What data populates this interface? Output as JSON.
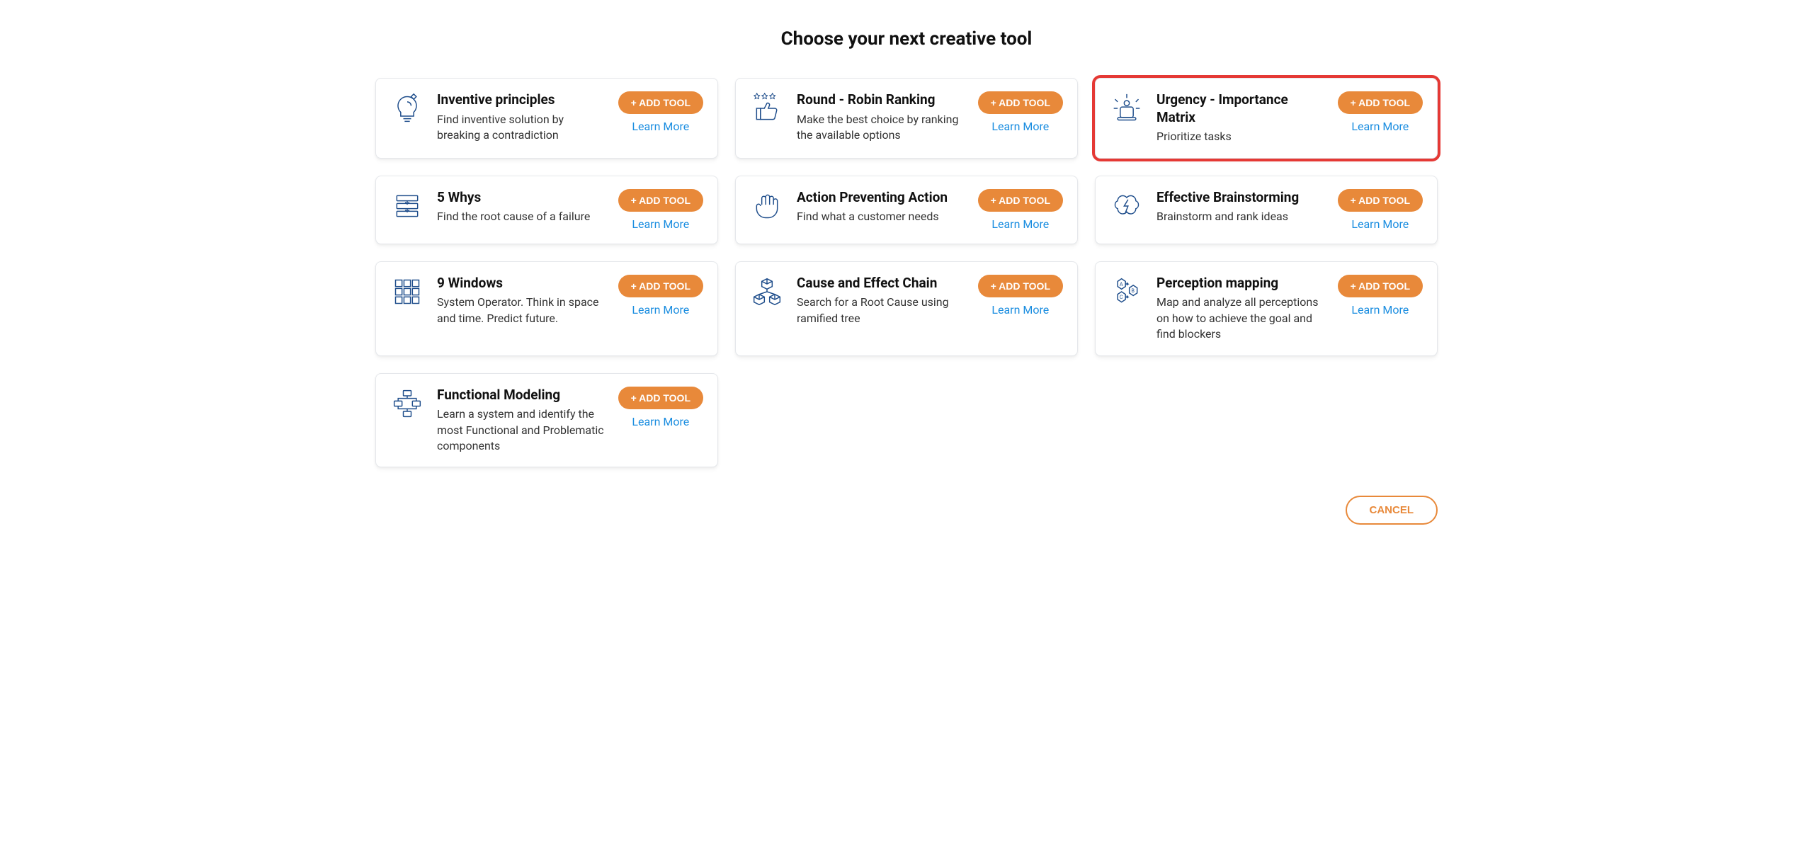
{
  "title": "Choose your next creative tool",
  "add_label": "+ ADD TOOL",
  "learn_label": "Learn More",
  "cancel_label": "CANCEL",
  "tools": [
    {
      "id": "inventive-principles",
      "title": "Inventive principles",
      "desc": "Find inventive solution by breaking a contradiction",
      "icon": "lightbulb-puzzle",
      "highlighted": false
    },
    {
      "id": "round-robin",
      "title": "Round - Robin Ranking",
      "desc": "Make the best choice by ranking the available options",
      "icon": "thumbs-stars",
      "highlighted": false
    },
    {
      "id": "urgency-importance",
      "title": "Urgency - Importance Matrix",
      "desc": "Prioritize tasks",
      "icon": "siren",
      "highlighted": true
    },
    {
      "id": "five-whys",
      "title": "5 Whys",
      "desc": "Find the root cause of a failure",
      "icon": "layers-down",
      "highlighted": false
    },
    {
      "id": "action-preventing",
      "title": "Action Preventing Action",
      "desc": "Find what a customer needs",
      "icon": "hand-stop",
      "highlighted": false
    },
    {
      "id": "effective-brainstorming",
      "title": "Effective Brainstorming",
      "desc": "Brainstorm and rank ideas",
      "icon": "brain-bolt",
      "highlighted": false
    },
    {
      "id": "nine-windows",
      "title": "9 Windows",
      "desc": "System Operator. Think in space and time. Predict future.",
      "icon": "grid-3x3",
      "highlighted": false
    },
    {
      "id": "cause-effect",
      "title": "Cause and Effect Chain",
      "desc": "Search for a Root Cause using ramified tree",
      "icon": "cube-tree",
      "highlighted": false
    },
    {
      "id": "perception-mapping",
      "title": "Perception mapping",
      "desc": "Map and analyze all perceptions on how to achieve the goal and find blockers",
      "icon": "hex-abc",
      "highlighted": false
    },
    {
      "id": "functional-modeling",
      "title": "Functional Modeling",
      "desc": "Learn a system and identify the most Functional and Problematic components",
      "icon": "flowchart",
      "highlighted": false
    }
  ]
}
